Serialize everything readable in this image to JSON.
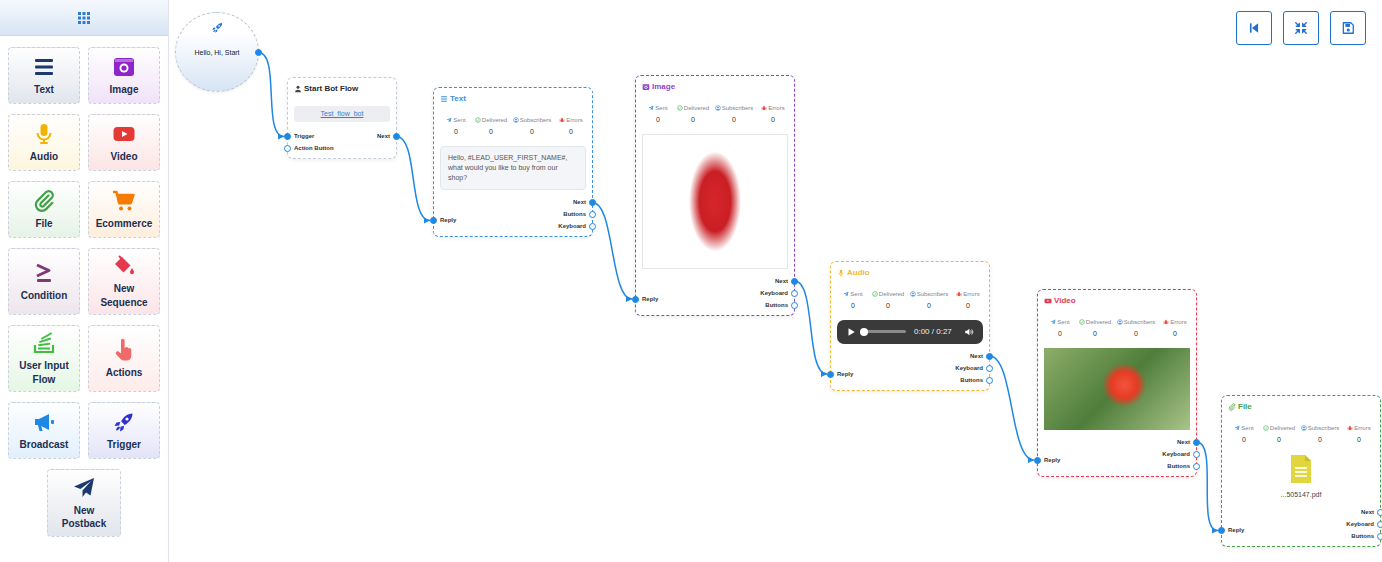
{
  "sidebar": {
    "items": [
      {
        "label": "Text",
        "color": "#1d3a6e"
      },
      {
        "label": "Image",
        "color": "#8e24c9"
      },
      {
        "label": "Audio",
        "color": "#f0b400"
      },
      {
        "label": "Video",
        "color": "#e53935"
      },
      {
        "label": "File",
        "color": "#43a047"
      },
      {
        "label": "Ecommerce",
        "color": "#f57c00"
      },
      {
        "label": "Condition",
        "color": "#7e3a75"
      },
      {
        "label": "New Sequence",
        "color": "#e53950"
      },
      {
        "label": "User Input Flow",
        "color": "#3fbf3f"
      },
      {
        "label": "Actions",
        "color": "#f06a6a"
      },
      {
        "label": "Broadcast",
        "color": "#1e88e5"
      },
      {
        "label": "Trigger",
        "color": "#3030d0"
      },
      {
        "label": "New Postback",
        "color": "#1d3a6e"
      }
    ]
  },
  "canvas": {
    "trigger": {
      "label": "Hello, Hi, Start",
      "connected": true
    },
    "start": {
      "title": "Start Bot Flow",
      "flow_name": "Test_flow_bot",
      "inputs": [
        {
          "label": "Trigger",
          "connected": true
        },
        {
          "label": "Action Button",
          "connected": false
        }
      ],
      "outputs": [
        {
          "label": "Next",
          "connected": true
        }
      ]
    },
    "nodes": [
      {
        "kind": "text",
        "title": "Text",
        "color": "#3b8fe0",
        "stats": [
          {
            "label": "Sent",
            "value": "0"
          },
          {
            "label": "Delivered",
            "value": "0"
          },
          {
            "label": "Subscribers",
            "value": "0"
          },
          {
            "label": "Errors",
            "value": "0"
          }
        ],
        "message": "Hello, #LEAD_USER_FIRST_NAME#, what would you like to buy from our shop?",
        "outputs": [
          {
            "label": "Next",
            "connected": true
          },
          {
            "label": "Buttons",
            "connected": false
          },
          {
            "label": "Keyboard",
            "connected": false
          }
        ],
        "input": {
          "label": "Reply",
          "connected": true
        }
      },
      {
        "kind": "image",
        "title": "Image",
        "color": "#8e44c9",
        "stats": [
          {
            "label": "Sent",
            "value": "0"
          },
          {
            "label": "Delivered",
            "value": "0"
          },
          {
            "label": "Subscribers",
            "value": "0"
          },
          {
            "label": "Errors",
            "value": "0"
          }
        ],
        "outputs": [
          {
            "label": "Next",
            "connected": true
          },
          {
            "label": "Keyboard",
            "connected": false
          },
          {
            "label": "Buttons",
            "connected": false
          }
        ],
        "input": {
          "label": "Reply",
          "connected": true
        }
      },
      {
        "kind": "audio",
        "title": "Audio",
        "color": "#f1b82d",
        "stats": [
          {
            "label": "Sent",
            "value": "0"
          },
          {
            "label": "Delivered",
            "value": "0"
          },
          {
            "label": "Subscribers",
            "value": "0"
          },
          {
            "label": "Errors",
            "value": "0"
          }
        ],
        "player": {
          "time": "0:00 / 0:27",
          "level": 0
        },
        "outputs": [
          {
            "label": "Next",
            "connected": true
          },
          {
            "label": "Keyboard",
            "connected": false
          },
          {
            "label": "Buttons",
            "connected": false
          }
        ],
        "input": {
          "label": "Reply",
          "connected": true
        }
      },
      {
        "kind": "video",
        "title": "Video",
        "color": "#e53950",
        "stats": [
          {
            "label": "Sent",
            "value": "0"
          },
          {
            "label": "Delivered",
            "value": "0"
          },
          {
            "label": "Subscribers",
            "value": "0"
          },
          {
            "label": "Errors",
            "value": "0"
          }
        ],
        "outputs": [
          {
            "label": "Next",
            "connected": true
          },
          {
            "label": "Keyboard",
            "connected": false
          },
          {
            "label": "Buttons",
            "connected": false
          }
        ],
        "input": {
          "label": "Reply",
          "connected": true
        }
      },
      {
        "kind": "file",
        "title": "File",
        "color": "#43a047",
        "stats": [
          {
            "label": "Sent",
            "value": "0"
          },
          {
            "label": "Delivered",
            "value": "0"
          },
          {
            "label": "Subscribers",
            "value": "0"
          },
          {
            "label": "Errors",
            "value": "0"
          }
        ],
        "file_name": "...505147.pdf",
        "outputs": [
          {
            "label": "Next",
            "connected": false
          },
          {
            "label": "Keyboard",
            "connected": false
          },
          {
            "label": "Buttons",
            "connected": false
          }
        ],
        "input": {
          "label": "Reply",
          "connected": true
        }
      }
    ]
  }
}
